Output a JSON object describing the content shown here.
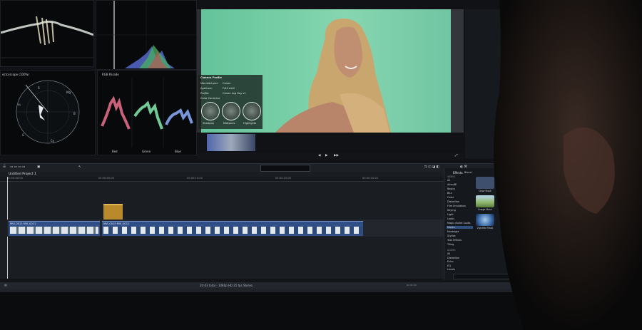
{
  "scopes": {
    "vectorscope_label": "ectorscope (100%)",
    "rgb_parade_label": "RGB Parade",
    "channel_labels": [
      "Red",
      "Green",
      "Blue"
    ]
  },
  "inspector": {
    "header": "Camera Profile",
    "rows": [
      {
        "label": "Manufacturer:",
        "value": "Canon"
      },
      {
        "label": "Aperture:",
        "value": "F/40 mkII"
      },
      {
        "label": "Profile:",
        "value": "Canon Log Gay v1"
      },
      {
        "label": "Color Corrector",
        "value": ""
      }
    ],
    "wheels": [
      "Shadows",
      "Midtones",
      "Highlights"
    ]
  },
  "timeline": {
    "project_title": "Untitled Project 1",
    "ruler": [
      "00:00:00:00",
      "00:00:05:00",
      "00:00:10:00",
      "00:00:15:00",
      "00:00:20:00"
    ],
    "clips": [
      {
        "label": "MVI_0011  MVI_0011"
      },
      {
        "label": "MVI_0019  MVI_0011"
      }
    ]
  },
  "effects": {
    "title": "Effects",
    "tab": "Blend",
    "section_video": "VIDEO",
    "categories": [
      "All",
      "Alien/Bl",
      "Basics",
      "Blur",
      "Color",
      "Distortion",
      "Film Emulation",
      "Keying",
      "Light",
      "Looks",
      "Magic Bullet Looks",
      "Masks",
      "Nostalgia",
      "Stylize",
      "Text Effects",
      "Tiling"
    ],
    "selected_index": 11,
    "section_audio": "AUDIO",
    "audio_categories": [
      "All",
      "Distortion",
      "Echo",
      "EQ",
      "Levels"
    ],
    "thumbs": [
      {
        "caption": "Draw Mask",
        "color": "#3d4f6c"
      },
      {
        "caption": "Image Mask",
        "color": "#8fb66a"
      },
      {
        "caption": "Vignette Mask",
        "color": "#3a6aa8"
      }
    ]
  },
  "statusbar": {
    "summary": "20:03 total - 1080p HD 25 fps Stereo"
  }
}
